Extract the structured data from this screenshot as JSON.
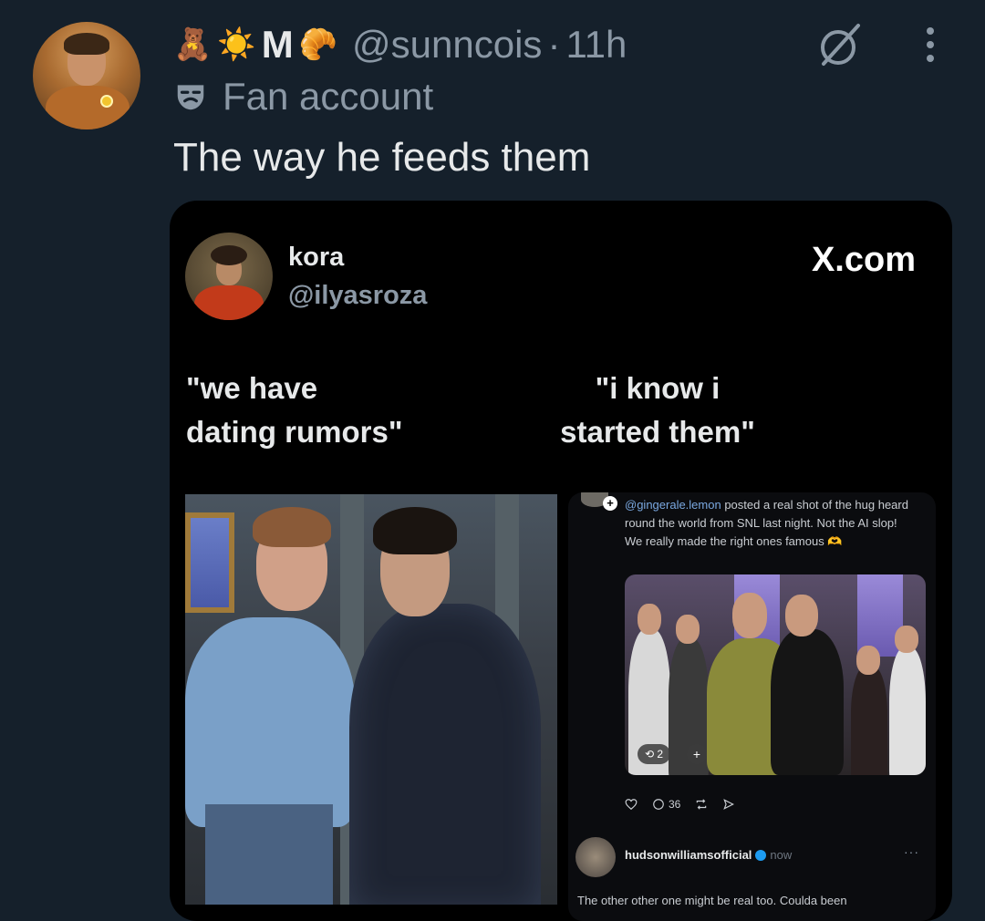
{
  "tweet": {
    "display_name_prefix_emojis": [
      "🧸",
      "☀️"
    ],
    "display_name": "M",
    "display_name_suffix_emoji": "🥐",
    "handle": "@sunncois",
    "separator": "·",
    "time": "11h",
    "label": "Fan account",
    "text": "The way he feeds them",
    "icons": [
      "avatar",
      "mask-icon",
      "grok-icon",
      "more-icon"
    ]
  },
  "media": {
    "author_name": "kora",
    "author_handle": "@ilyasroza",
    "watermark": "X.com",
    "caption_left": "\"we have\ndating rumors\"",
    "caption_right": "\"i know i\nstarted them\"",
    "embedded_post": {
      "link_handle": "@gingerale.lemon",
      "body": " posted a real shot of the hug heard round the world from SNL last night. Not the AI slop! We really made the right ones famous",
      "emoji": "🫶",
      "plus_badge": "+",
      "image_counter": "2",
      "add_button": "+",
      "reply_count": "36",
      "reply_user": "hudsonwilliamsofficial",
      "reply_time": "now",
      "reply_more": "···",
      "reply_text": "The other other one might be real too. Coulda been"
    }
  }
}
